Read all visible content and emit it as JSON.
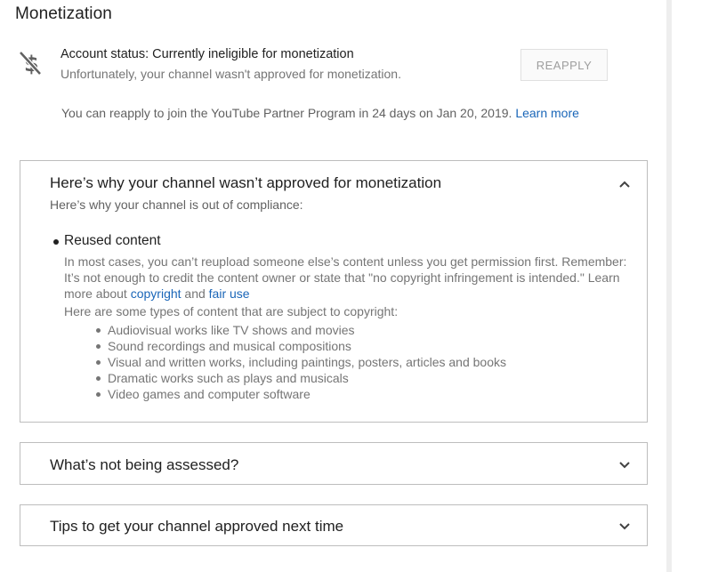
{
  "page": {
    "title": "Monetization"
  },
  "account_status": {
    "icon": "no-money-icon",
    "title": "Account status: Currently ineligible for monetization",
    "description": "Unfortunately, your channel wasn't approved for monetization.",
    "reapply_button": "REAPPLY",
    "note_text": "You can reapply to join the YouTube Partner Program in 24 days on Jan 20, 2019. ",
    "learn_more": "Learn more"
  },
  "sections": {
    "why": {
      "heading": "Here’s why your channel wasn’t approved for monetization",
      "subheading": "Here’s why your channel is out of compliance:",
      "expanded": true,
      "reason_title": "Reused content",
      "reason_text": "In most cases, you can’t reupload someone else’s content unless you get permission first. Remember: It’s not enough to credit the content owner or state that \"no copyright infringement is intended.\" Learn more about ",
      "copyright_link": "copyright",
      "and_text": " and ",
      "fair_use_link": "fair use",
      "types_intro": "Here are some types of content that are subject to copyright:",
      "types": [
        "Audiovisual works like TV shows and movies",
        "Sound recordings and musical compositions",
        "Visual and written works, including paintings, posters, articles and books",
        "Dramatic works such as plays and musicals",
        "Video games and computer software"
      ]
    },
    "not_assessed": {
      "heading": "What’s not being assessed?",
      "expanded": false
    },
    "tips": {
      "heading": "Tips to get your channel approved next time",
      "expanded": false
    }
  },
  "colors": {
    "link": "#1a66b8",
    "text_primary": "#212121",
    "text_secondary": "#757575",
    "border": "#bdbdbd"
  }
}
